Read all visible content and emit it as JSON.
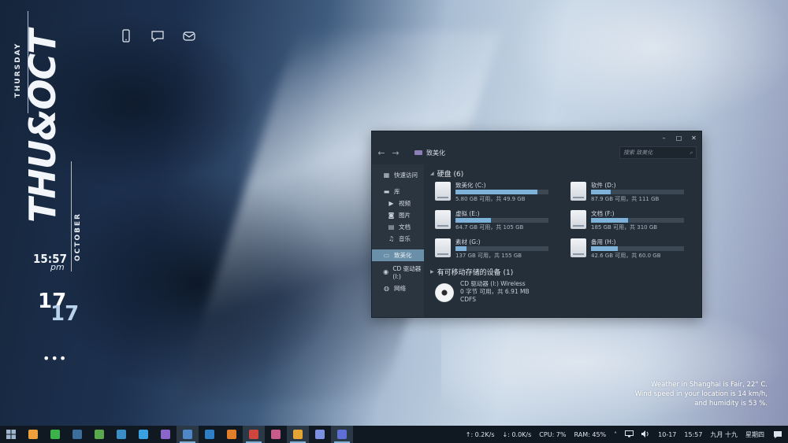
{
  "clock": {
    "day_month": "THU&OCT",
    "day_full": "THURSDAY",
    "month_full": "OCTOBER",
    "time": "15:57",
    "meridiem": "pm",
    "day_num": "17",
    "day_num_shadow": "17",
    "more": "•••"
  },
  "desktop_icons": [
    "phone-icon",
    "chat-icon",
    "mail-icon"
  ],
  "explorer": {
    "controls": {
      "minimize": "–",
      "maximize": "□",
      "close": "✕"
    },
    "back": "←",
    "forward": "→",
    "breadcrumb": "致美化",
    "search_placeholder": "搜索 致美化",
    "nav": [
      {
        "label": "快速访问",
        "icon": "grid-icon",
        "sub": false,
        "selected": false
      },
      {
        "label": "库",
        "icon": "folder-icon",
        "sub": false,
        "selected": false
      },
      {
        "label": "视频",
        "icon": "video-icon",
        "sub": true,
        "selected": false
      },
      {
        "label": "图片",
        "icon": "picture-icon",
        "sub": true,
        "selected": false
      },
      {
        "label": "文档",
        "icon": "document-icon",
        "sub": true,
        "selected": false
      },
      {
        "label": "音乐",
        "icon": "music-icon",
        "sub": true,
        "selected": false
      },
      {
        "label": "致美化",
        "icon": "computer-icon",
        "sub": false,
        "selected": true
      },
      {
        "label": "CD 驱动器 (I:)",
        "icon": "disc-icon",
        "sub": false,
        "selected": false
      },
      {
        "label": "网络",
        "icon": "network-icon",
        "sub": false,
        "selected": false
      }
    ],
    "drives_header": "硬盘 (6)",
    "drives": [
      {
        "name": "致美化 (C:)",
        "free": "5.80 GB 可用，共 49.9 GB",
        "used_fraction": 0.88
      },
      {
        "name": "软件 (D:)",
        "free": "87.9 GB 可用，共 111 GB",
        "used_fraction": 0.21
      },
      {
        "name": "虚拟 (E:)",
        "free": "64.7 GB 可用，共 105 GB",
        "used_fraction": 0.38
      },
      {
        "name": "文档 (F:)",
        "free": "185 GB 可用，共 310 GB",
        "used_fraction": 0.4
      },
      {
        "name": "素材 (G:)",
        "free": "137 GB 可用，共 155 GB",
        "used_fraction": 0.12
      },
      {
        "name": "备用 (H:)",
        "free": "42.6 GB 可用，共 60.0 GB",
        "used_fraction": 0.29
      }
    ],
    "removable_header": "有可移动存储的设备 (1)",
    "cd": {
      "name": "CD 驱动器 (I:) Wireless",
      "free": "0 字节 可用，共 6.91 MB",
      "fs": "CDFS"
    }
  },
  "weather": {
    "line1": "Weather in Shanghai is Fair, 22° C.",
    "line2": "Wind speed in your location is 14 km/h,",
    "line3": "and humidity is 53 %."
  },
  "taskbar": {
    "apps": [
      {
        "name": "start-icon",
        "color": "#9fb6cc",
        "active": false
      },
      {
        "name": "app-orange-icon",
        "color": "#f0a03a",
        "active": false
      },
      {
        "name": "wechat-icon",
        "color": "#3cb34a",
        "active": false
      },
      {
        "name": "ps-icon",
        "color": "#3c6e9c",
        "active": false
      },
      {
        "name": "ai-icon",
        "color": "#59a84d",
        "active": false
      },
      {
        "name": "photos-icon",
        "color": "#3b8fc4",
        "active": false
      },
      {
        "name": "edge-icon",
        "color": "#3ba0e0",
        "active": false
      },
      {
        "name": "media-icon",
        "color": "#8b66c9",
        "active": false
      },
      {
        "name": "notepad-icon",
        "color": "#4f88c7",
        "active": true
      },
      {
        "name": "mail-app-icon",
        "color": "#2f7fc6",
        "active": false
      },
      {
        "name": "office-icon",
        "color": "#e27d2a",
        "active": false
      },
      {
        "name": "record-icon",
        "color": "#d0463f",
        "active": true
      },
      {
        "name": "paint-icon",
        "color": "#c75c8b",
        "active": false
      },
      {
        "name": "files-icon",
        "color": "#e5a534",
        "active": true
      },
      {
        "name": "qq-icon",
        "color": "#7d8fe0",
        "active": false
      },
      {
        "name": "settings-app-icon",
        "color": "#5f6fd6",
        "active": true
      }
    ],
    "net_up": "↑: 0.2K/s",
    "net_down": "↓: 0.0K/s",
    "cpu": "CPU: 7%",
    "ram": "RAM: 45%",
    "date": "10-17",
    "time": "15:57",
    "lunar": "九月 十九",
    "weekday": "星期四"
  }
}
